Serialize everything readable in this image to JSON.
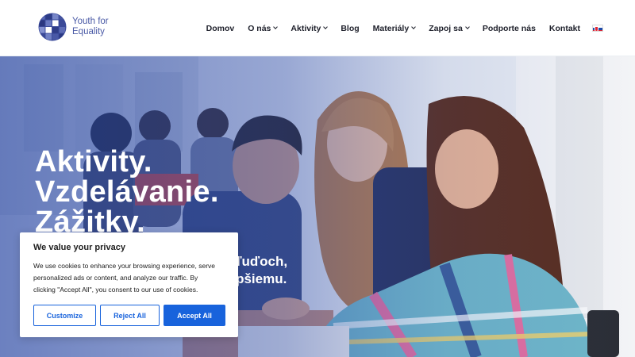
{
  "brand": {
    "name_line1": "Youth for",
    "name_line2": "Equality",
    "color": "#4a5aa6"
  },
  "nav": {
    "items": [
      {
        "label": "Domov",
        "has_dropdown": false
      },
      {
        "label": "O nás",
        "has_dropdown": true
      },
      {
        "label": "Aktivity",
        "has_dropdown": true
      },
      {
        "label": "Blog",
        "has_dropdown": false
      },
      {
        "label": "Materiály",
        "has_dropdown": true
      },
      {
        "label": "Zapoj sa",
        "has_dropdown": true
      },
      {
        "label": "Podporte nás",
        "has_dropdown": false
      },
      {
        "label": "Kontakt",
        "has_dropdown": false
      }
    ],
    "language_icon": "slovak-flag-icon"
  },
  "hero": {
    "title_lines": [
      "Aktivity.",
      "Vzdelávanie.",
      "Zážitky."
    ],
    "subtitle_lines": [
      "... o ľuďoch,",
      "... lepšiemu."
    ]
  },
  "cookie": {
    "title": "We value your privacy",
    "text_line1": "We use cookies to enhance your browsing experience, serve",
    "text_line2": "personalized ads or content, and analyze our traffic. By",
    "text_line3": "clicking \"Accept All\", you consent to our use of cookies.",
    "customize_label": "Customize",
    "reject_label": "Reject All",
    "accept_label": "Accept All",
    "accent_color": "#1863dc"
  }
}
